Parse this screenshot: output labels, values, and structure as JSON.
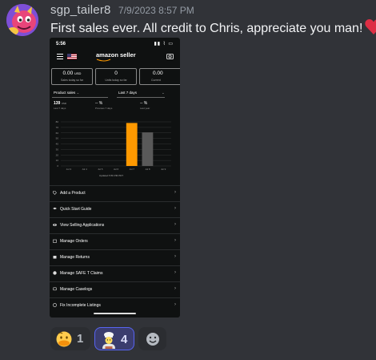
{
  "message": {
    "username": "sgp_tailer8",
    "timestamp": "7/9/2023 8:57 PM",
    "text": "First sales ever. All credit to Chris, appreciate you man!",
    "username_color": "#c9cdd2",
    "heart_color": "#dd2e44",
    "avatar_icon": "pink-creature-avatar"
  },
  "screenshot": {
    "status_time": "5:56",
    "status_icons": "▮▮ ⌇ ▭",
    "brand": "amazon seller",
    "metrics": [
      {
        "value": "0.00",
        "unit": "USD",
        "label": "Sales today so far"
      },
      {
        "value": "0",
        "unit": "",
        "label": "Units today so far"
      },
      {
        "value": "0.00",
        "unit": "",
        "label": "Current"
      }
    ],
    "selectors": {
      "left": "Product sales",
      "right": "Last 7 days"
    },
    "stats": [
      {
        "value": "139",
        "unit": "USD",
        "label": "Last 7 days"
      },
      {
        "value": "-- %",
        "unit": "",
        "label": "Previous 7 days"
      },
      {
        "value": "-- %",
        "unit": "",
        "label": "Last year"
      }
    ],
    "updated": "Updated 5:56 PM PDT",
    "menu": [
      {
        "label": "Add a Product",
        "icon": "tag-icon"
      },
      {
        "label": "Quick Start Guide",
        "icon": "graduation-cap-icon"
      },
      {
        "label": "View Selling Applications",
        "icon": "eye-icon"
      },
      {
        "label": "Manage Orders",
        "icon": "box-icon"
      },
      {
        "label": "Manage Returns",
        "icon": "return-box-icon"
      },
      {
        "label": "Manage SAFE T Claims",
        "icon": "globe-icon"
      },
      {
        "label": "Manage Caselogs",
        "icon": "chat-icon"
      },
      {
        "label": "Fix Incomplete Listings",
        "icon": "info-icon"
      }
    ]
  },
  "chart_data": {
    "type": "bar",
    "categories": [
      "Jul 3",
      "Jul 4",
      "Jul 5",
      "Jul 6",
      "Jul 7",
      "Jul 8",
      "Jul 9"
    ],
    "series": [
      {
        "values": [
          0,
          0,
          0,
          0,
          78,
          0,
          0
        ],
        "color": "#ff9900"
      },
      {
        "values": [
          0,
          0,
          0,
          0,
          0,
          61,
          0
        ],
        "color": "#595959"
      }
    ],
    "yticks": [
      "0",
      "10",
      "20",
      "30",
      "40",
      "50",
      "60",
      "70",
      "80"
    ],
    "ylim": [
      0,
      80
    ],
    "grid": true
  },
  "reactions": [
    {
      "icon": "face-with-hand-over-mouth-icon",
      "count": "1",
      "active": false
    },
    {
      "icon": "chef-icon",
      "count": "4",
      "active": true
    },
    {
      "icon": "add-reaction-icon",
      "count": "",
      "active": false
    }
  ]
}
